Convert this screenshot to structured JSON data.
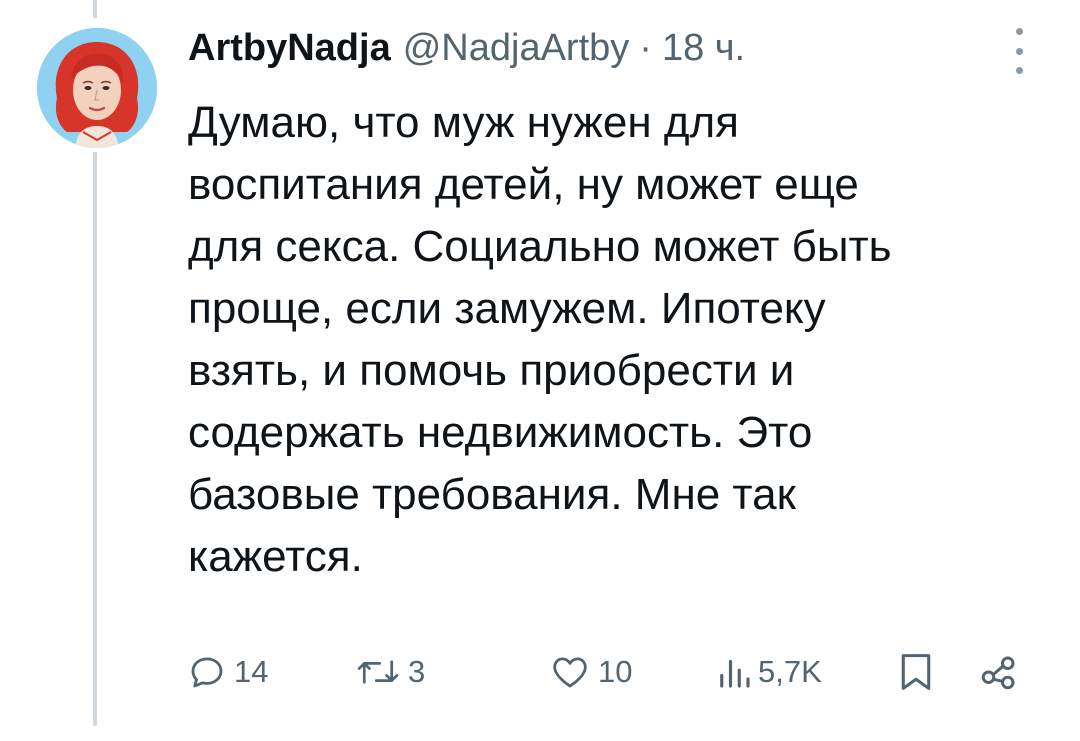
{
  "tweet": {
    "display_name": "ArtbyNadja",
    "handle": "@NadjaArtby",
    "separator": "·",
    "time": "18 ч.",
    "text_lines": [
      "Думаю, что муж нужен для",
      "воспитания детей, ну может еще",
      "для секса. Социально может быть",
      "проще, если замужем. Ипотеку",
      "взять, и помочь приобрести и",
      "содержать недвижимость. Это",
      "базовые требования. Мне так",
      "кажется."
    ]
  },
  "actions": {
    "replies": "14",
    "retweets": "3",
    "likes": "10",
    "views": "5,7K"
  },
  "icons": {
    "reply": "reply-icon",
    "retweet": "retweet-icon",
    "like": "heart-icon",
    "views": "views-chart-icon",
    "bookmark": "bookmark-icon",
    "share": "share-icon",
    "more": "more-vertical-icon"
  },
  "colors": {
    "text": "#0f1419",
    "secondary": "#536471",
    "thread_line": "#cfd9de",
    "avatar_bg": "#8fd1f0",
    "avatar_hair": "#d8352a"
  }
}
